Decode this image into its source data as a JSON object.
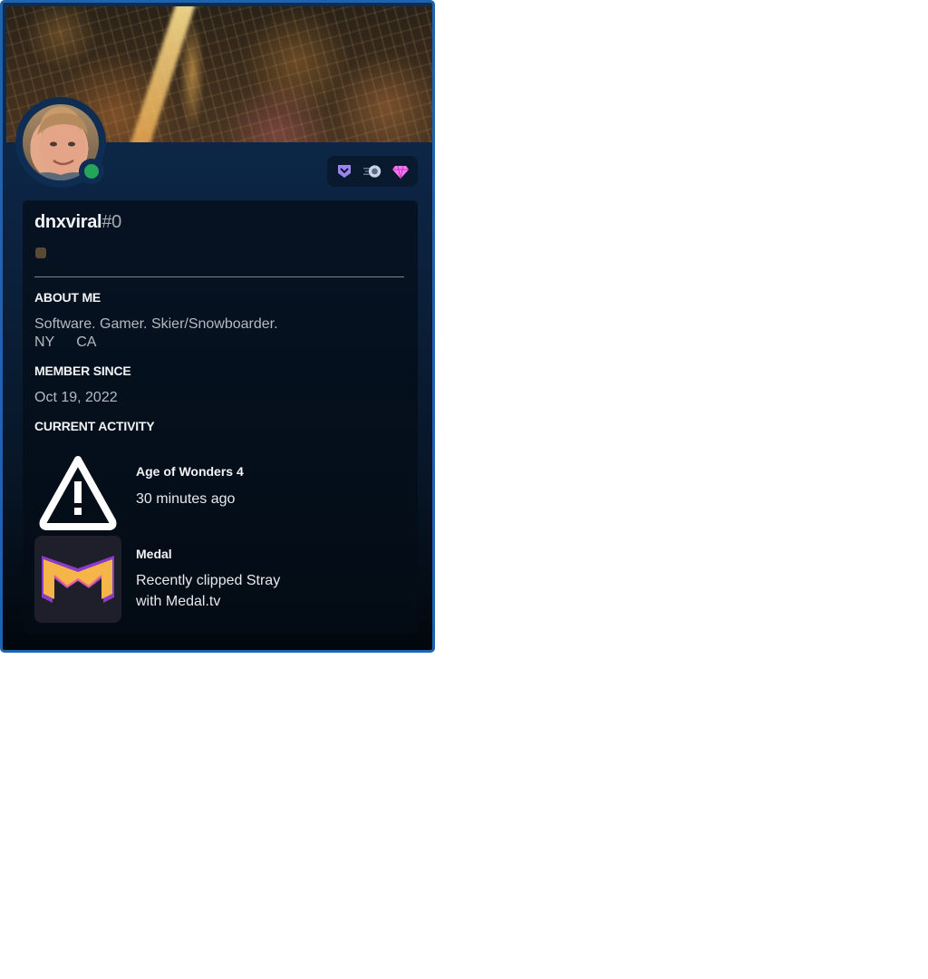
{
  "profile": {
    "username": "dnxviral",
    "discriminator": "#0",
    "status": "online",
    "status_color": "#23a55a",
    "accent_border": "#1f63b0"
  },
  "badges": [
    {
      "icon": "hypesquad-badge-icon",
      "color": "#9b84ee"
    },
    {
      "icon": "nitro-boost-badge-icon",
      "color": "#c9d3e8"
    },
    {
      "icon": "gem-badge-icon",
      "color": "#ff73fa"
    }
  ],
  "about": {
    "title": "ABOUT ME",
    "line1": "Software. Gamer. Skier/Snowboarder.",
    "loc1": "NY",
    "loc2": "CA"
  },
  "member_since": {
    "title": "MEMBER SINCE",
    "date": "Oct 19, 2022"
  },
  "activity": {
    "title": "CURRENT ACTIVITY",
    "items": [
      {
        "name": "Age of Wonders 4",
        "detail": "30 minutes ago",
        "icon": "warning-icon"
      },
      {
        "name": "Medal",
        "detail_line1": "Recently clipped Stray",
        "detail_line2": "with Medal.tv",
        "icon": "medal-app-icon"
      }
    ]
  }
}
